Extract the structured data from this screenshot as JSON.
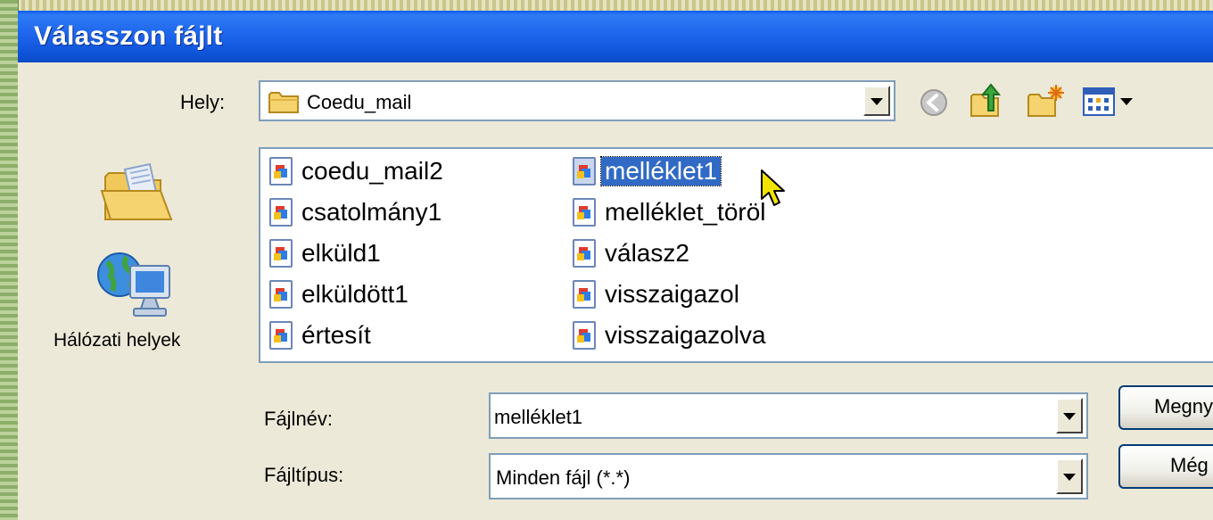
{
  "window": {
    "title": "Válasszon fájlt"
  },
  "location": {
    "label": "Hely:",
    "value": "Coedu_mail"
  },
  "toolbar": {
    "icons": [
      "back-icon",
      "up-folder-icon",
      "new-folder-icon",
      "view-menu-icon"
    ]
  },
  "places": {
    "items": [
      {
        "label": "Hálózati helyek",
        "icon": "network-places-icon"
      }
    ]
  },
  "files": {
    "column1": [
      "coedu_mail2",
      "csatolmány1",
      "elküld1",
      "elküldött1",
      "értesít"
    ],
    "column2": [
      "melléklet1",
      "melléklet_töröl",
      "válasz2",
      "visszaigazol",
      "visszaigazolva"
    ],
    "selected": "melléklet1"
  },
  "filename": {
    "label": "Fájlnév:",
    "value": "melléklet1"
  },
  "filetype": {
    "label": "Fájltípus:",
    "value": "Minden fájl (*.*)"
  },
  "buttons": {
    "open": "Megny",
    "cancel": "Még"
  },
  "colors": {
    "title_bar": "#0A5BEA",
    "selection": "#316AC5",
    "dialog_bg": "#ECE9D8"
  }
}
